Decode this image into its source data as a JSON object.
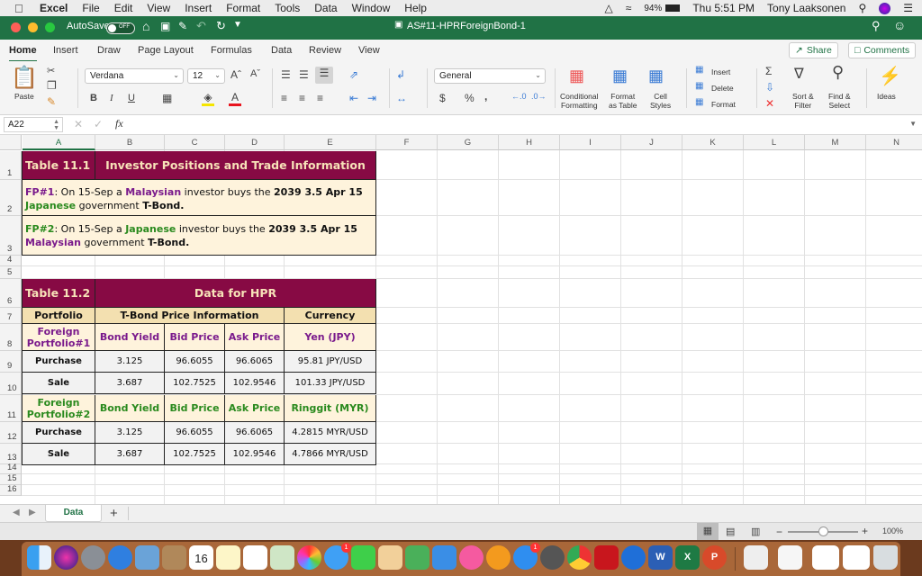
{
  "menubar": {
    "app": "Excel",
    "items": [
      "File",
      "Edit",
      "View",
      "Insert",
      "Format",
      "Tools",
      "Data",
      "Window",
      "Help"
    ],
    "battery": "94%",
    "clock": "Thu 5:51 PM",
    "user": "Tony Laaksonen"
  },
  "titlebar": {
    "autosave_label": "AutoSave",
    "autosave_state": "OFF",
    "doc_title": "AS#11-HPRForeignBond-1"
  },
  "tabs": [
    "Home",
    "Insert",
    "Draw",
    "Page Layout",
    "Formulas",
    "Data",
    "Review",
    "View"
  ],
  "active_tab": "Home",
  "share_label": "Share",
  "comments_label": "Comments",
  "ribbon": {
    "paste": "Paste",
    "font": "Verdana",
    "font_size": "12",
    "number_format": "General",
    "conditional": [
      "Conditional",
      "Formatting"
    ],
    "format_table": [
      "Format",
      "as Table"
    ],
    "cell_styles": [
      "Cell",
      "Styles"
    ],
    "insert": "Insert",
    "delete": "Delete",
    "format": "Format",
    "sort": [
      "Sort &",
      "Filter"
    ],
    "find": [
      "Find &",
      "Select"
    ],
    "ideas": "Ideas",
    "bold": "B",
    "italic": "I",
    "underline": "U"
  },
  "formula_bar": {
    "name_box": "A22",
    "fx": "fx",
    "value": ""
  },
  "columns": [
    "A",
    "B",
    "C",
    "D",
    "E",
    "F",
    "G",
    "H",
    "I",
    "J",
    "K",
    "L",
    "M",
    "N"
  ],
  "rows": [
    "1",
    "2",
    "3",
    "4",
    "5",
    "6",
    "7",
    "8",
    "9",
    "10",
    "11",
    "12",
    "13",
    "14",
    "15",
    "16"
  ],
  "table1": {
    "label": "Table 11.1",
    "title": "Investor Positions and Trade Information",
    "fp1": {
      "id": "FP#1",
      "t1": ": On 15-Sep a ",
      "nat1": "Malaysian",
      "t2": " investor buys the ",
      "bond": "2039 3.5 Apr 15",
      "nat2": "Japanese",
      "t3": " government ",
      "tb": "T-Bond."
    },
    "fp2": {
      "id": "FP#2",
      "t1": ": On 15-Sep a ",
      "nat1": "Japanese",
      "t2": " investor buys the ",
      "bond": "2039 3.5 Apr 15",
      "nat2": "Malaysian",
      "t3": " government ",
      "tb": "T-Bond."
    }
  },
  "table2": {
    "label": "Table 11.2",
    "title": "Data for HPR",
    "headers": {
      "portfolio": "Portfolio",
      "tbond": "T-Bond Price Information",
      "currency": "Currency"
    },
    "p1": {
      "name": "Foreign Portfolio#1",
      "cols": [
        "Bond Yield",
        "Bid Price",
        "Ask Price"
      ],
      "currency": "Yen (JPY)",
      "rows": [
        {
          "label": "Purchase",
          "yield": "3.125",
          "bid": "96.6055",
          "ask": "96.6065",
          "fx": "95.81 JPY/USD"
        },
        {
          "label": "Sale",
          "yield": "3.687",
          "bid": "102.7525",
          "ask": "102.9546",
          "fx": "101.33 JPY/USD"
        }
      ]
    },
    "p2": {
      "name": "Foreign Portfolio#2",
      "cols": [
        "Bond Yield",
        "Bid Price",
        "Ask Price"
      ],
      "currency": "Ringgit (MYR)",
      "rows": [
        {
          "label": "Purchase",
          "yield": "3.125",
          "bid": "96.6055",
          "ask": "96.6065",
          "fx": "4.2815 MYR/USD"
        },
        {
          "label": "Sale",
          "yield": "3.687",
          "bid": "102.7525",
          "ask": "102.9546",
          "fx": "4.7866 MYR/USD"
        }
      ]
    }
  },
  "sheets": [
    "Data"
  ],
  "zoom": "100%",
  "zoom_level": 0.5,
  "dock": {
    "calendar_day": "16",
    "messages_badge": "1",
    "appstore_badge": "1"
  },
  "colors": {
    "excel_green": "#207245",
    "maroon": "#870a44",
    "tan": "#f3e0b0",
    "cream": "#fef3dc",
    "purple": "#7a1a8c",
    "green": "#2a8a1e"
  }
}
